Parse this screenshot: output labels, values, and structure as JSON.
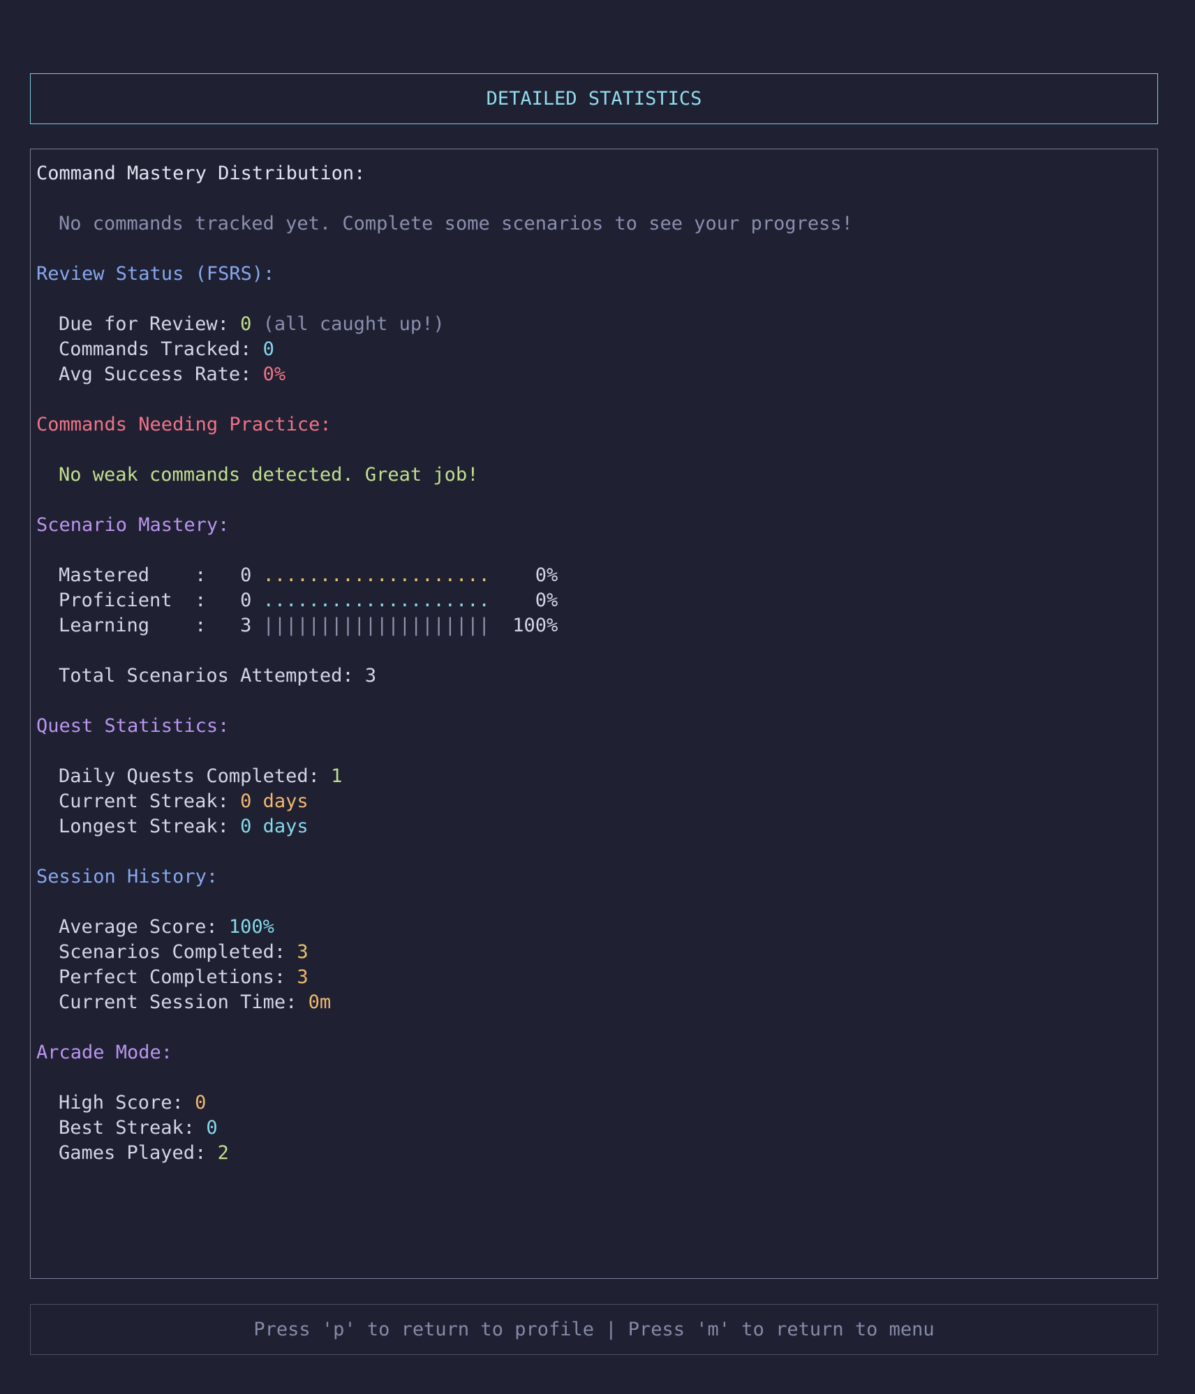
{
  "header": {
    "title": "DETAILED STATISTICS"
  },
  "command_mastery": {
    "heading": "Command Mastery Distribution:",
    "empty_message": "No commands tracked yet. Complete some scenarios to see your progress!"
  },
  "review_status": {
    "heading": "Review Status (FSRS):",
    "due_label": "Due for Review: ",
    "due_value": "0",
    "due_note": " (all caught up!)",
    "tracked_label": "Commands Tracked: ",
    "tracked_value": "0",
    "success_label": "Avg Success Rate: ",
    "success_value": "0%"
  },
  "needing_practice": {
    "heading": "Commands Needing Practice:",
    "message": "No weak commands detected. Great job!"
  },
  "scenario_mastery": {
    "heading": "Scenario Mastery:",
    "rows": [
      {
        "label": "Mastered    :   ",
        "count": "0",
        "bar": "....................",
        "percent": "    0%"
      },
      {
        "label": "Proficient  :   ",
        "count": "0",
        "bar": "....................",
        "percent": "    0%"
      },
      {
        "label": "Learning    :   ",
        "count": "3",
        "bar": "||||||||||||||||||||",
        "percent": "  100%"
      }
    ],
    "total_label": "Total Scenarios Attempted: ",
    "total_value": "3"
  },
  "quest_statistics": {
    "heading": "Quest Statistics:",
    "daily_label": "Daily Quests Completed: ",
    "daily_value": "1",
    "current_label": "Current Streak: ",
    "current_value": "0 days",
    "longest_label": "Longest Streak: ",
    "longest_value": "0 days"
  },
  "session_history": {
    "heading": "Session History:",
    "avg_label": "Average Score: ",
    "avg_value": "100%",
    "completed_label": "Scenarios Completed: ",
    "completed_value": "3",
    "perfect_label": "Perfect Completions: ",
    "perfect_value": "3",
    "time_label": "Current Session Time: ",
    "time_value": "0m"
  },
  "arcade_mode": {
    "heading": "Arcade Mode:",
    "high_label": "High Score: ",
    "high_value": "0",
    "streak_label": "Best Streak: ",
    "streak_value": "0",
    "games_label": "Games Played: ",
    "games_value": "2"
  },
  "footer": {
    "hint": "Press 'p' to return to profile | Press 'm' to return to menu"
  }
}
